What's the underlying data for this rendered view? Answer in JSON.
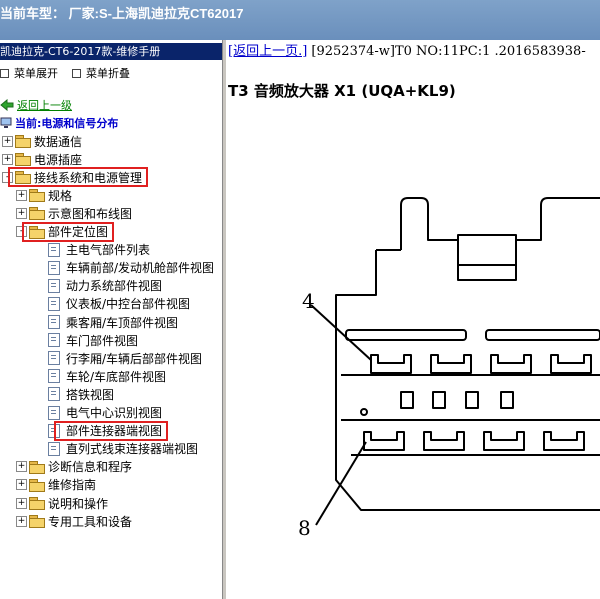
{
  "app_title": "当前车型：  厂家:S-上海凯迪拉克CT62017",
  "left_panel": {
    "title": "凯迪拉克-CT6-2017款-维修手册",
    "toolbar": {
      "expand_label": "菜单展开",
      "collapse_label": "菜单折叠"
    },
    "back_link": "返回上一级",
    "current": "当前:电源和信号分布",
    "tree": [
      {
        "label": "数据通信",
        "type": "folder",
        "expander": "+",
        "highlighted": false
      },
      {
        "label": "电源插座",
        "type": "folder",
        "expander": "+",
        "highlighted": false
      },
      {
        "label": "接线系统和电源管理",
        "type": "folder",
        "expander": "-",
        "highlighted": true
      },
      {
        "label": "规格",
        "type": "folder",
        "expander": "+",
        "highlighted": false
      },
      {
        "label": "示意图和布线图",
        "type": "folder",
        "expander": "+",
        "highlighted": false
      },
      {
        "label": "部件定位图",
        "type": "folder",
        "expander": "-",
        "highlighted": true
      },
      {
        "label": "主电气部件列表",
        "type": "doc",
        "highlighted": false
      },
      {
        "label": "车辆前部/发动机舱部件视图",
        "type": "doc",
        "highlighted": false
      },
      {
        "label": "动力系统部件视图",
        "type": "doc",
        "highlighted": false
      },
      {
        "label": "仪表板/中控台部件视图",
        "type": "doc",
        "highlighted": false
      },
      {
        "label": "乘客厢/车顶部件视图",
        "type": "doc",
        "highlighted": false
      },
      {
        "label": "车门部件视图",
        "type": "doc",
        "highlighted": false
      },
      {
        "label": "行李厢/车辆后部部件视图",
        "type": "doc",
        "highlighted": false
      },
      {
        "label": "车轮/车底部件视图",
        "type": "doc",
        "highlighted": false
      },
      {
        "label": "搭铁视图",
        "type": "doc",
        "highlighted": false
      },
      {
        "label": "电气中心识别视图",
        "type": "doc",
        "highlighted": false
      },
      {
        "label": "部件连接器端视图",
        "type": "doc",
        "highlighted": true
      },
      {
        "label": "直列式线束连接器端视图",
        "type": "doc",
        "highlighted": false
      },
      {
        "label": "诊断信息和程序",
        "type": "folder",
        "expander": "+",
        "highlighted": false
      },
      {
        "label": "维修指南",
        "type": "folder",
        "expander": "+",
        "highlighted": false
      },
      {
        "label": "说明和操作",
        "type": "folder",
        "expander": "+",
        "highlighted": false
      },
      {
        "label": "专用工具和设备",
        "type": "folder",
        "expander": "+",
        "highlighted": false
      }
    ]
  },
  "right_panel": {
    "back_link": "[返回上一页.]",
    "nav_info": " [9252374-w]T0 NO:11PC:1 .2016583938-",
    "title": "T3 音频放大器 X1 (UQA+KL9)",
    "diagram": {
      "pin_label_top": "4",
      "pin_label_bottom": "8"
    }
  },
  "colors": {
    "title_bar": "#6a8fbc",
    "panel_title_bg": "#0a246a",
    "highlight": "#e02020",
    "link": "#0000cc",
    "back_link": "#008000"
  }
}
